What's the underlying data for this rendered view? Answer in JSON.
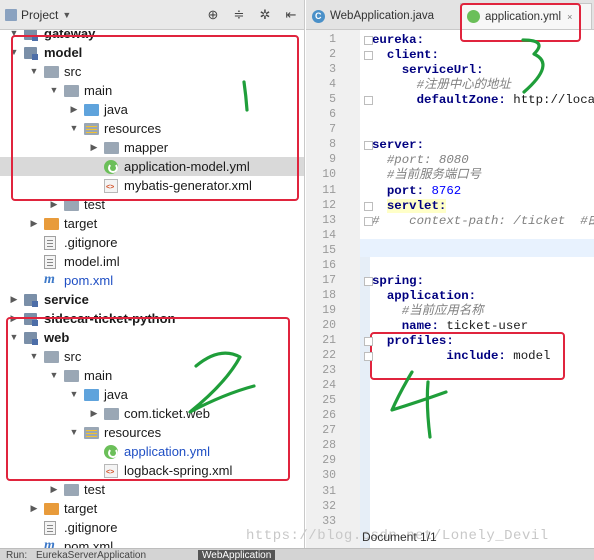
{
  "project_panel": {
    "title": "Project",
    "dropdown_icon": "chevron-down-icon",
    "tools": [
      "crosshair-icon",
      "collapse-all-icon",
      "settings-icon",
      "hide-icon"
    ],
    "tree": [
      {
        "label": "gateway",
        "level": 1,
        "arrow": "down",
        "icon": "module",
        "bold": true
      },
      {
        "label": "model",
        "level": 1,
        "arrow": "down",
        "icon": "module",
        "bold": true
      },
      {
        "label": "src",
        "level": 2,
        "arrow": "down",
        "icon": "folder-grey"
      },
      {
        "label": "main",
        "level": 3,
        "arrow": "down",
        "icon": "folder-grey"
      },
      {
        "label": "java",
        "level": 4,
        "arrow": "right",
        "icon": "folder-blue"
      },
      {
        "label": "resources",
        "level": 4,
        "arrow": "down",
        "icon": "folder-res"
      },
      {
        "label": "mapper",
        "level": 5,
        "arrow": "right",
        "icon": "folder-grey"
      },
      {
        "label": "application-model.yml",
        "level": 5,
        "arrow": "",
        "icon": "spring",
        "selected": true
      },
      {
        "label": "mybatis-generator.xml",
        "level": 5,
        "arrow": "",
        "icon": "xml"
      },
      {
        "label": "test",
        "level": 3,
        "arrow": "right",
        "icon": "folder-grey"
      },
      {
        "label": "target",
        "level": 2,
        "arrow": "right",
        "icon": "folder-orange"
      },
      {
        "label": ".gitignore",
        "level": 2,
        "arrow": "",
        "icon": "doc"
      },
      {
        "label": "model.iml",
        "level": 2,
        "arrow": "",
        "icon": "doc"
      },
      {
        "label": "pom.xml",
        "level": 2,
        "arrow": "",
        "icon": "maven",
        "blue": true
      },
      {
        "label": "service",
        "level": 1,
        "arrow": "right",
        "icon": "module",
        "bold": true
      },
      {
        "label": "sidecar-ticket-python",
        "level": 1,
        "arrow": "right",
        "icon": "module",
        "bold": true
      },
      {
        "label": "web",
        "level": 1,
        "arrow": "down",
        "icon": "module",
        "bold": true
      },
      {
        "label": "src",
        "level": 2,
        "arrow": "down",
        "icon": "folder-grey"
      },
      {
        "label": "main",
        "level": 3,
        "arrow": "down",
        "icon": "folder-grey"
      },
      {
        "label": "java",
        "level": 4,
        "arrow": "down",
        "icon": "folder-blue"
      },
      {
        "label": "com.ticket.web",
        "level": 5,
        "arrow": "right",
        "icon": "folder-grey"
      },
      {
        "label": "resources",
        "level": 4,
        "arrow": "down",
        "icon": "folder-res"
      },
      {
        "label": "application.yml",
        "level": 5,
        "arrow": "",
        "icon": "spring",
        "blue": true
      },
      {
        "label": "logback-spring.xml",
        "level": 5,
        "arrow": "",
        "icon": "xml"
      },
      {
        "label": "test",
        "level": 3,
        "arrow": "right",
        "icon": "folder-grey"
      },
      {
        "label": "target",
        "level": 2,
        "arrow": "right",
        "icon": "folder-orange"
      },
      {
        "label": ".gitignore",
        "level": 2,
        "arrow": "",
        "icon": "doc"
      },
      {
        "label": "pom.xml",
        "level": 2,
        "arrow": "",
        "icon": "maven"
      }
    ]
  },
  "editor": {
    "tabs": [
      {
        "label": "WebApplication.java",
        "icon": "java-class-icon",
        "active": false
      },
      {
        "label": "application.yml",
        "icon": "spring-yml-icon",
        "active": true,
        "close": "×"
      }
    ],
    "lines": [
      {
        "n": "1",
        "parts": [
          [
            "k",
            "eureka:"
          ]
        ]
      },
      {
        "n": "2",
        "parts": [
          [
            "k",
            "  client:"
          ]
        ]
      },
      {
        "n": "3",
        "parts": [
          [
            "k",
            "    serviceUrl:"
          ]
        ]
      },
      {
        "n": "4",
        "parts": [
          [
            "c",
            "      #注册中心的地址"
          ]
        ]
      },
      {
        "n": "5",
        "parts": [
          [
            "k",
            "      defaultZone: "
          ],
          [
            "plain",
            "http://localh"
          ]
        ]
      },
      {
        "n": "6",
        "parts": []
      },
      {
        "n": "7",
        "parts": []
      },
      {
        "n": "8",
        "parts": [
          [
            "k",
            "server:"
          ]
        ]
      },
      {
        "n": "9",
        "parts": [
          [
            "c",
            "  #port: 8080"
          ]
        ]
      },
      {
        "n": "10",
        "parts": [
          [
            "c",
            "  #当前服务端口号"
          ]
        ]
      },
      {
        "n": "11",
        "parts": [
          [
            "k",
            "  port: "
          ],
          [
            "n",
            "8762"
          ]
        ]
      },
      {
        "n": "12",
        "parts": [
          [
            "plain",
            "  "
          ],
          [
            "k hlbox",
            "servlet:"
          ]
        ]
      },
      {
        "n": "13",
        "parts": [
          [
            "c",
            "#    context-path: /ticket  #由于"
          ]
        ]
      },
      {
        "n": "14",
        "parts": []
      },
      {
        "n": "15",
        "parts": []
      },
      {
        "n": "16",
        "parts": []
      },
      {
        "n": "17",
        "parts": [
          [
            "k",
            "spring:"
          ]
        ]
      },
      {
        "n": "18",
        "parts": [
          [
            "k",
            "  application:"
          ]
        ]
      },
      {
        "n": "19",
        "parts": [
          [
            "c",
            "    #当前应用名称"
          ]
        ]
      },
      {
        "n": "20",
        "parts": [
          [
            "k",
            "    name: "
          ],
          [
            "plain",
            "ticket-user"
          ]
        ]
      },
      {
        "n": "21",
        "parts": [
          [
            "k",
            "  profiles:"
          ]
        ]
      },
      {
        "n": "22",
        "parts": [
          [
            "k",
            "          include: "
          ],
          [
            "plain",
            "model"
          ]
        ]
      },
      {
        "n": "23",
        "parts": []
      },
      {
        "n": "24",
        "parts": []
      },
      {
        "n": "25",
        "parts": []
      },
      {
        "n": "26",
        "parts": []
      },
      {
        "n": "27",
        "parts": []
      },
      {
        "n": "28",
        "parts": []
      },
      {
        "n": "29",
        "parts": []
      },
      {
        "n": "30",
        "parts": []
      },
      {
        "n": "31",
        "parts": []
      },
      {
        "n": "32",
        "parts": []
      },
      {
        "n": "33",
        "parts": []
      }
    ],
    "status": "Document 1/1"
  },
  "bottom_tabs": [
    {
      "label": "Run:",
      "active": false
    },
    {
      "label": "EurekaServerApplication",
      "active": false
    },
    {
      "label": "WebApplication",
      "active": true
    }
  ],
  "watermark": "https://blog.csdn.net/Lonely_Devil",
  "annotations": {
    "color": "#e0243d",
    "pen_color": "#1f9e3a",
    "handwritten_numbers": [
      "1",
      "2",
      "3",
      "4"
    ]
  }
}
